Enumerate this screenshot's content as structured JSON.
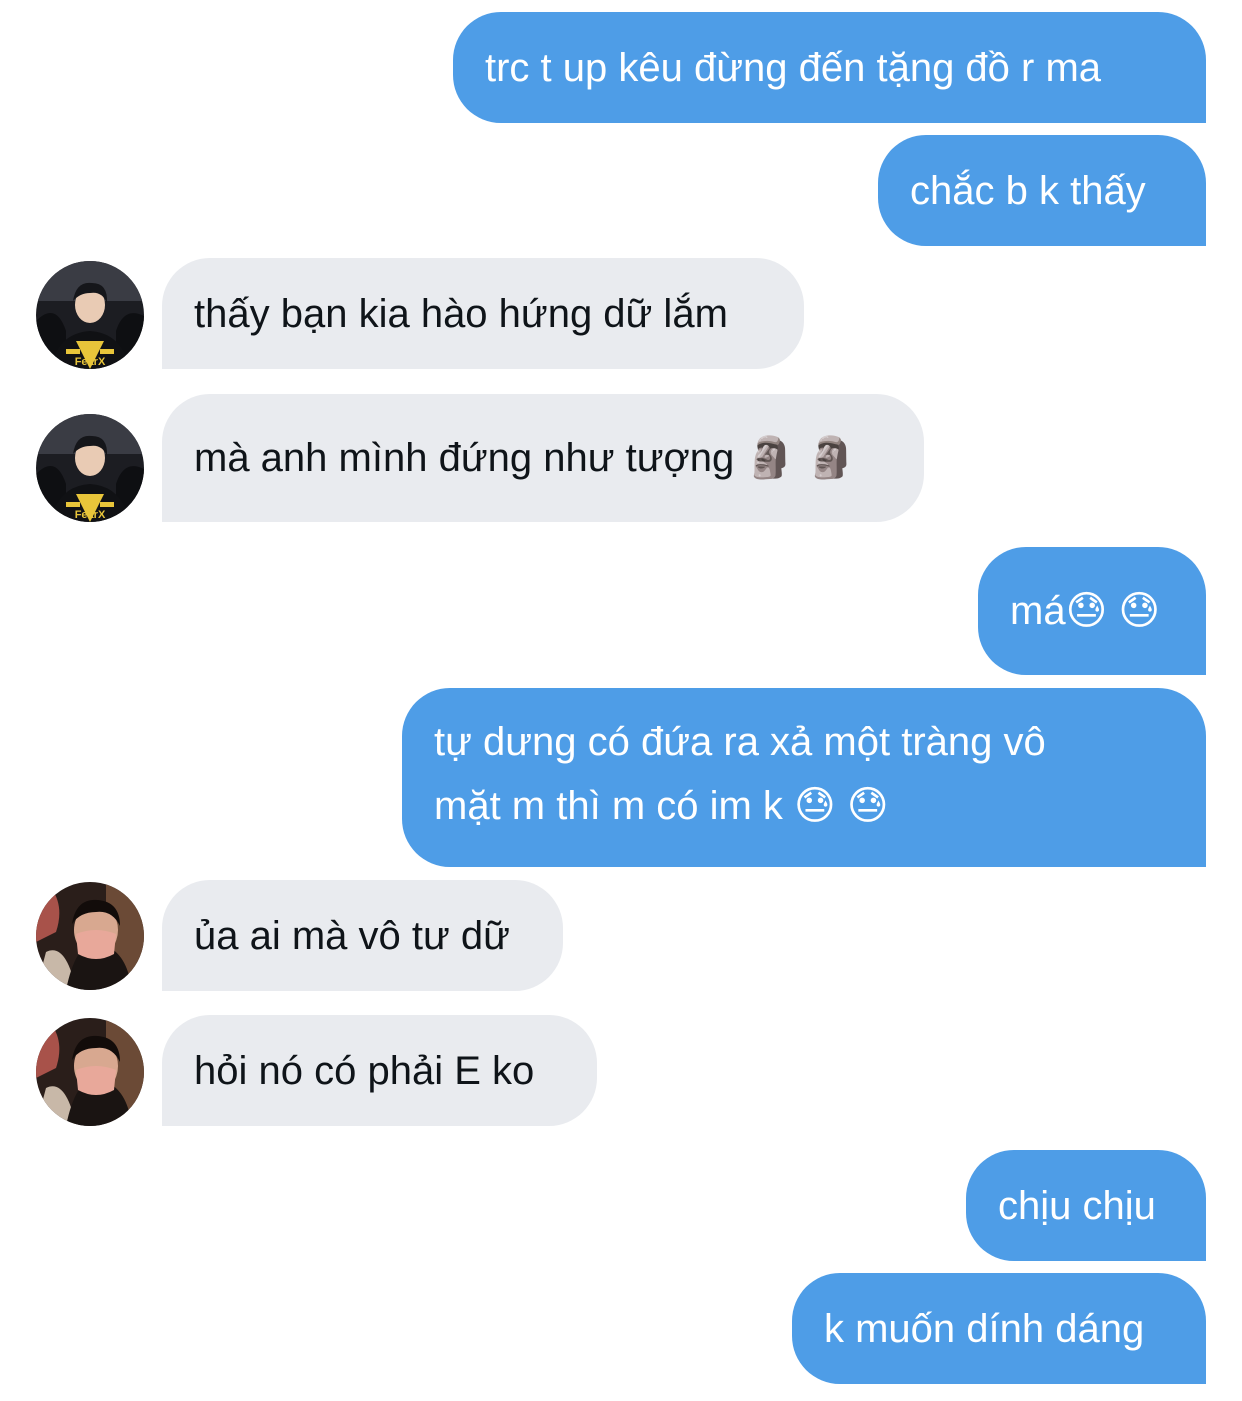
{
  "conversation": {
    "messages": [
      {
        "sender": "me",
        "text": "trc t up kêu đừng đến tặng đồ r ma"
      },
      {
        "sender": "me",
        "text": "chắc b k thấy"
      },
      {
        "sender": "them",
        "avatar": "player-jersey-avatar",
        "text": "thấy bạn kia hào hứng dữ lắm"
      },
      {
        "sender": "them",
        "avatar": "player-jersey-avatar",
        "text": "mà anh mình đứng như tượng 🗿 🗿"
      },
      {
        "sender": "me",
        "text": "má😓 😓"
      },
      {
        "sender": "me",
        "lines": [
          "tự dưng có đứa ra xả một tràng vô",
          "mặt m thì m có im k 😓 😓"
        ]
      },
      {
        "sender": "them",
        "avatar": "masked-selfie-avatar",
        "text": "ủa ai mà vô tư dữ"
      },
      {
        "sender": "them",
        "avatar": "masked-selfie-avatar",
        "text": "hỏi nó có phải E ko"
      },
      {
        "sender": "me",
        "text": "chịu chịu"
      },
      {
        "sender": "me",
        "text": "k muốn dính dáng"
      }
    ]
  },
  "jersey_brand": "FearX",
  "colors": {
    "outgoing_bubble": "#4e9de7",
    "incoming_bubble": "#e9ebef",
    "outgoing_text": "#ffffff",
    "incoming_text": "#0f1419"
  }
}
